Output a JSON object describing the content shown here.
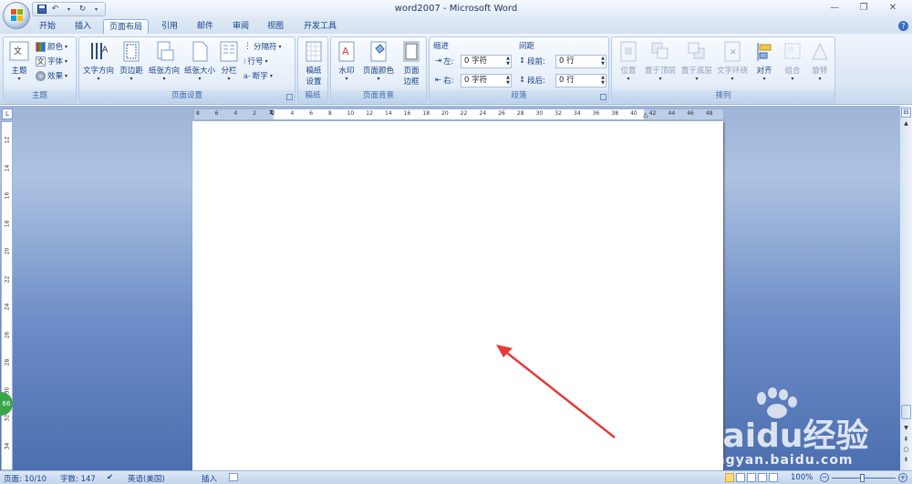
{
  "title_bar": {
    "title": "word2007 - Microsoft Word"
  },
  "tabs": [
    "开始",
    "插入",
    "页面布局",
    "引用",
    "邮件",
    "审阅",
    "视图",
    "开发工具"
  ],
  "active_tab": "页面布局",
  "ribbon": {
    "theme_group": {
      "label": "主题",
      "theme_button": "主题",
      "colors": "颜色",
      "fonts": "字体",
      "effects": "效果"
    },
    "page_setup_group": {
      "label": "页面设置",
      "text_direction": "文字方向",
      "margins": "页边距",
      "orientation": "纸张方向",
      "size": "纸张大小",
      "columns": "分栏",
      "breaks": "分隔符",
      "line_numbers": "行号",
      "hyphenation": "断字"
    },
    "manuscript_group": {
      "label": "稿纸",
      "button": "稿纸\n设置",
      "line1": "稿纸",
      "line2": "设置"
    },
    "page_background_group": {
      "label": "页面背景",
      "watermark": "水印",
      "page_color": "页面颜色",
      "page_borders_1": "页面",
      "page_borders_2": "边框"
    },
    "paragraph_group": {
      "label": "段落",
      "indent_label": "缩进",
      "left_label": "左:",
      "left_value": "0 字符",
      "right_label": "右:",
      "right_value": "0 字符",
      "spacing_label": "间距",
      "before_label": "段前:",
      "before_value": "0 行",
      "after_label": "段后:",
      "after_value": "0 行"
    },
    "arrange_group": {
      "label": "排列",
      "position": "位置",
      "bring_front": "置于顶层",
      "send_back": "置于底层",
      "text_wrap": "文字环绕",
      "align": "对齐",
      "group": "组合",
      "rotate": "旋转"
    }
  },
  "ruler": {
    "h_ticks": [
      "8",
      "6",
      "4",
      "2",
      "2",
      "4",
      "6",
      "8",
      "10",
      "12",
      "14",
      "16",
      "18",
      "20",
      "22",
      "24",
      "26",
      "28",
      "30",
      "32",
      "34",
      "36",
      "38",
      "40",
      "42",
      "44",
      "46",
      "48"
    ],
    "v_ticks": [
      "12",
      "14",
      "16",
      "18",
      "20",
      "22",
      "24",
      "26",
      "28",
      "30",
      "32",
      "34"
    ],
    "corner": "L"
  },
  "status_bar": {
    "page": "页面: 10/10",
    "words": "字数: 147",
    "language": "英语(美国)",
    "mode": "插入",
    "zoom": "100%"
  },
  "badge": "66",
  "watermark": {
    "brand": "Baidu经验",
    "url": "jingyan.baidu.com"
  },
  "colors": {
    "accent": "#15428b",
    "arrow": "#e63b3b",
    "ribbon": "#dbe6f4",
    "workspace": "#6c8cc6"
  }
}
